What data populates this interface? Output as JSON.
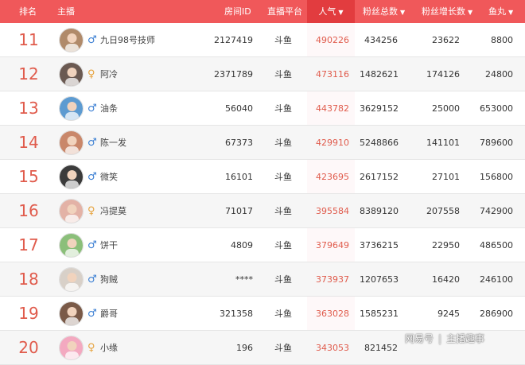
{
  "header": {
    "rank": "排名",
    "streamer": "主播",
    "room_id": "房间ID",
    "platform": "直播平台",
    "popularity": "人气",
    "fans_total": "粉丝总数",
    "fans_growth": "粉丝增长数",
    "fish_balls": "鱼丸"
  },
  "colors": {
    "header_bg": "#f0585a",
    "active_header": "#e23c3f",
    "rank": "#e05b4c",
    "male": "#3b7fd3",
    "female": "#e6a23c"
  },
  "rows": [
    {
      "rank": "11",
      "gender": "male",
      "name": "九日98号技师",
      "room_id": "2127419",
      "platform": "斗鱼",
      "popularity": "490226",
      "fans_total": "434256",
      "fans_growth": "23622",
      "fish": "8800"
    },
    {
      "rank": "12",
      "gender": "female",
      "name": "阿冷",
      "room_id": "2371789",
      "platform": "斗鱼",
      "popularity": "473116",
      "fans_total": "1482621",
      "fans_growth": "174126",
      "fish": "24800"
    },
    {
      "rank": "13",
      "gender": "male",
      "name": "油条",
      "room_id": "56040",
      "platform": "斗鱼",
      "popularity": "443782",
      "fans_total": "3629152",
      "fans_growth": "25000",
      "fish": "653000"
    },
    {
      "rank": "14",
      "gender": "male",
      "name": "陈一发",
      "room_id": "67373",
      "platform": "斗鱼",
      "popularity": "429910",
      "fans_total": "5248866",
      "fans_growth": "141101",
      "fish": "789600"
    },
    {
      "rank": "15",
      "gender": "male",
      "name": "微笑",
      "room_id": "16101",
      "platform": "斗鱼",
      "popularity": "423695",
      "fans_total": "2617152",
      "fans_growth": "27101",
      "fish": "156800"
    },
    {
      "rank": "16",
      "gender": "female",
      "name": "冯提莫",
      "room_id": "71017",
      "platform": "斗鱼",
      "popularity": "395584",
      "fans_total": "8389120",
      "fans_growth": "207558",
      "fish": "742900"
    },
    {
      "rank": "17",
      "gender": "male",
      "name": "饼干",
      "room_id": "4809",
      "platform": "斗鱼",
      "popularity": "379649",
      "fans_total": "3736215",
      "fans_growth": "22950",
      "fish": "486500"
    },
    {
      "rank": "18",
      "gender": "male",
      "name": "狗贼",
      "room_id": "****",
      "platform": "斗鱼",
      "popularity": "373937",
      "fans_total": "1207653",
      "fans_growth": "16420",
      "fish": "246100"
    },
    {
      "rank": "19",
      "gender": "male",
      "name": "爵哥",
      "room_id": "321358",
      "platform": "斗鱼",
      "popularity": "363028",
      "fans_total": "1585231",
      "fans_growth": "9245",
      "fish": "286900"
    },
    {
      "rank": "20",
      "gender": "female",
      "name": "小缘",
      "room_id": "196",
      "platform": "斗鱼",
      "popularity": "343053",
      "fans_total": "821452",
      "fans_growth": "",
      "fish": ""
    }
  ],
  "watermark": {
    "left": "网易号",
    "right": "主播趣事"
  }
}
